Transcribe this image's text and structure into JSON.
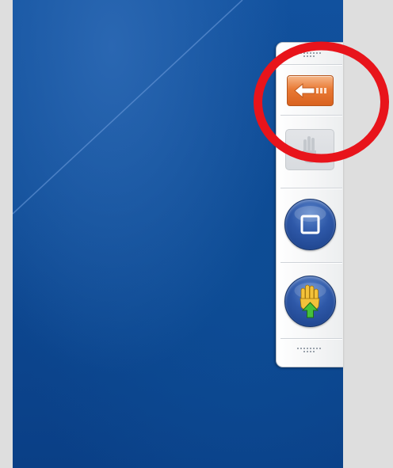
{
  "toolbar": {
    "buttons": [
      {
        "name": "back",
        "icon": "arrow-left-icon",
        "state": "active",
        "color": "#e97a35"
      },
      {
        "name": "hand-tool",
        "icon": "hand-icon",
        "state": "disabled",
        "color": "#d8dbdf"
      },
      {
        "name": "stop",
        "icon": "square-icon",
        "state": "normal",
        "color": "#2e58a8"
      },
      {
        "name": "hand-upload",
        "icon": "hand-upload-icon",
        "state": "normal",
        "color": "#2e58a8"
      }
    ]
  },
  "annotation": {
    "shape": "circle",
    "color": "#e8141b",
    "target": "back"
  },
  "desktop": {
    "background_color": "#0f4c96"
  }
}
